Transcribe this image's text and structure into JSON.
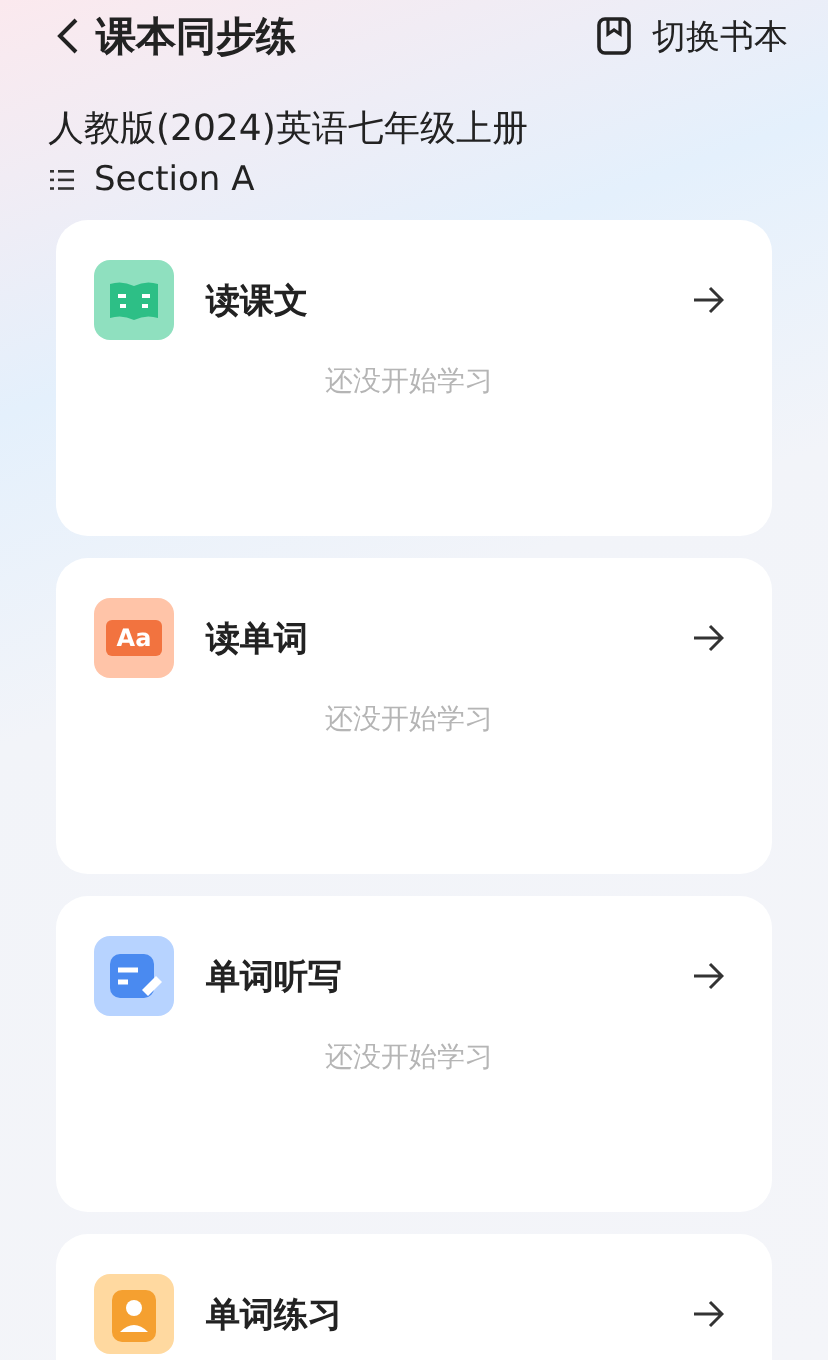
{
  "header": {
    "title": "课本同步练",
    "switch_button": "切换书本"
  },
  "book": {
    "name": "人教版(2024)英语七年级上册",
    "section": "Section A"
  },
  "modules": [
    {
      "kind": "book",
      "title": "读课文",
      "status": "还没开始学习"
    },
    {
      "kind": "letters",
      "icon_text": "Aa",
      "title": "读单词",
      "status": "还没开始学习"
    },
    {
      "kind": "pen",
      "title": "单词听写",
      "status": "还没开始学习"
    },
    {
      "kind": "person",
      "title": "单词练习"
    }
  ]
}
